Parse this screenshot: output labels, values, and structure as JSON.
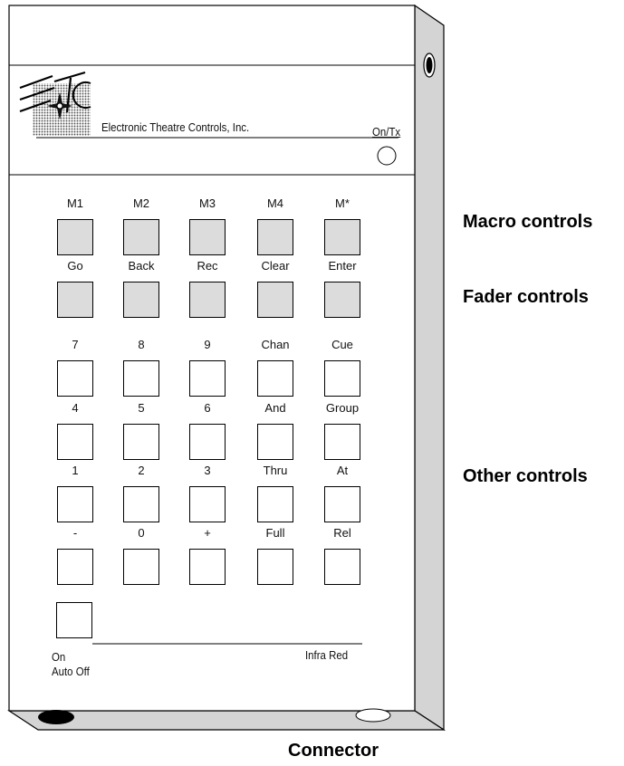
{
  "brand": {
    "logo_text": "ETC",
    "company": "Electronic Theatre Controls, Inc.",
    "on_tx_label": "On/Tx"
  },
  "key_rows": [
    {
      "style": "gray",
      "labels": [
        "M1",
        "M2",
        "M3",
        "M4",
        "M*"
      ]
    },
    {
      "style": "gray",
      "labels": [
        "Go",
        "Back",
        "Rec",
        "Clear",
        "Enter"
      ]
    },
    {
      "style": "white",
      "labels": [
        "7",
        "8",
        "9",
        "Chan",
        "Cue"
      ]
    },
    {
      "style": "white",
      "labels": [
        "4",
        "5",
        "6",
        "And",
        "Group"
      ]
    },
    {
      "style": "white",
      "labels": [
        "1",
        "2",
        "3",
        "Thru",
        "At"
      ]
    },
    {
      "style": "white",
      "labels": [
        "-",
        "0",
        "+",
        "Full",
        "Rel"
      ]
    }
  ],
  "bottom": {
    "on_label": "On",
    "auto_off_label": "Auto Off",
    "infra_red_label": "Infra Red"
  },
  "callouts": {
    "macro": "Macro controls",
    "fader": "Fader controls",
    "other": "Other controls",
    "connector": "Connector"
  },
  "colors": {
    "gray_key": "#dcdcdc",
    "body_side": "#d4d4d4",
    "outline": "#000000"
  }
}
